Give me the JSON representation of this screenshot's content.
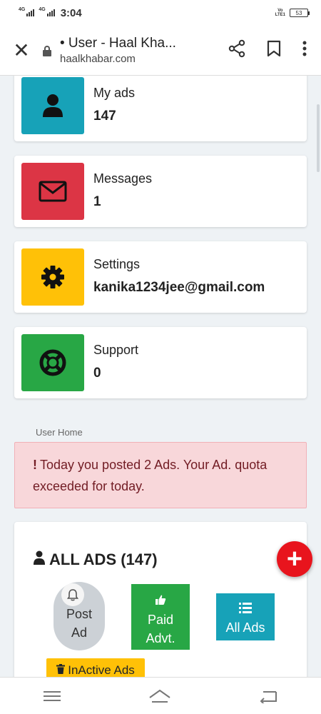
{
  "status_bar": {
    "network_1": "4G",
    "network_2": "4G",
    "time": "3:04",
    "volte": "Vo\nLTE1",
    "battery": "53"
  },
  "browser": {
    "title": "• User - Haal Kha...",
    "domain": "haalkhabar.com"
  },
  "stats": [
    {
      "label": "My ads",
      "value": "147",
      "icon": "user-icon",
      "color": "#17a2b8"
    },
    {
      "label": "Messages",
      "value": "1",
      "icon": "envelope-icon",
      "color": "#dc3545"
    },
    {
      "label": "Settings",
      "value": "kanika1234jee@gmail.com",
      "icon": "gear-icon",
      "color": "#ffc107"
    },
    {
      "label": "Support",
      "value": "0",
      "icon": "lifebuoy-icon",
      "color": "#28a745"
    }
  ],
  "breadcrumb": "User Home",
  "alert": {
    "text": "Today you posted 2 Ads. Your Ad. quota exceeded for today.",
    "icon": "exclamation-icon"
  },
  "ads_section": {
    "title": "ALL ADS (147)",
    "post_ad_line1": "Post",
    "post_ad_line2": "Ad",
    "paid_line1": "Paid",
    "paid_line2": "Advt.",
    "all_ads": "All Ads",
    "inactive_ads": "InActive Ads"
  },
  "fab": "+"
}
